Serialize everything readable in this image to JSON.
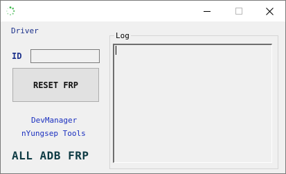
{
  "window": {
    "title": "",
    "icon": "loading-spinner-icon",
    "controls": {
      "minimize": "minimize-icon",
      "maximize": "maximize-icon",
      "close": "close-icon"
    }
  },
  "driver": {
    "label": "Driver"
  },
  "id_field": {
    "label": "ID",
    "value": ""
  },
  "reset_button": {
    "label": "RESET FRP"
  },
  "links": {
    "dev_manager": "DevManager",
    "tools": "nYungsep Tools"
  },
  "footer_title": "ALL ADB FRP",
  "log": {
    "label": "Log",
    "content": ""
  },
  "colors": {
    "label_blue": "#1a2f8a",
    "link_blue": "#1a2fbf",
    "title_teal": "#0e3b44",
    "icon_green": "#3cb54a"
  }
}
